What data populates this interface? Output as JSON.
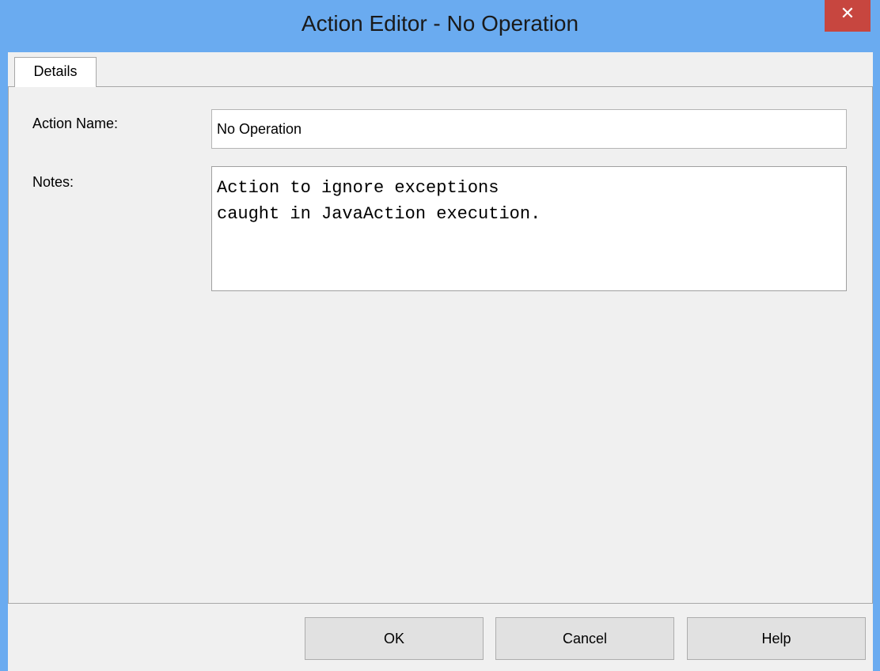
{
  "window": {
    "title": "Action Editor - No Operation",
    "close_glyph": "✕"
  },
  "tabs": [
    {
      "label": "Details",
      "selected": true
    }
  ],
  "form": {
    "action_name_label": "Action Name:",
    "action_name_value": "No Operation",
    "notes_label": "Notes:",
    "notes_value": "Action to ignore exceptions\ncaught in JavaAction execution."
  },
  "buttons": {
    "ok_label": "OK",
    "cancel_label": "Cancel",
    "help_label": "Help"
  },
  "colors": {
    "titlebar": "#6aabf0",
    "close_button": "#c7463f",
    "panel_bg": "#f0f0f0"
  }
}
